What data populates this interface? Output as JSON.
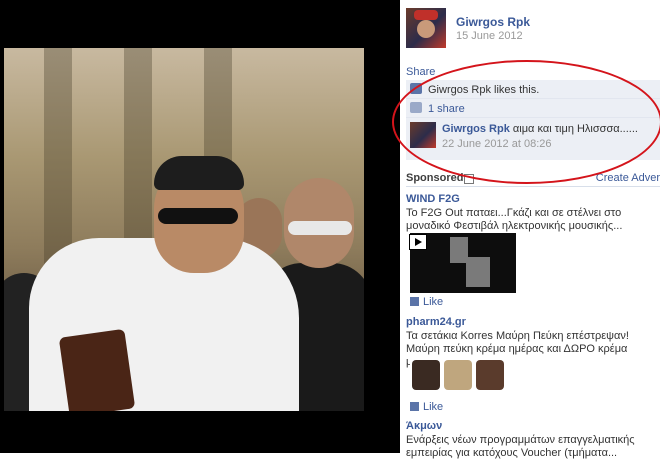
{
  "post": {
    "author": "Giwrgos Rpk",
    "date": "15 June 2012",
    "share_label": "Share",
    "likes_text": "Giwrgos Rpk likes this.",
    "shares_text": "1 share",
    "comment": {
      "author": "Giwrgos Rpk",
      "text": "αιμα και τιμη Ηλισσσα......",
      "time": "22 June 2012 at 08:26"
    }
  },
  "sponsored": {
    "label": "Sponsored",
    "create_advert": "Create Adver"
  },
  "ads": [
    {
      "title": "WIND F2G",
      "text": "Το F2G Out παταει...Γκάζι και σε στέλνει στο μοναδικό Φεστιβάλ ηλεκτρονικής μουσικής...",
      "like_label": "Like"
    },
    {
      "title": "pharm24.gr",
      "text": "Τα σετάκια Korres Μαύρη Πεύκη επέστρεψαν! Μαύρη πεύκη κρέμα ημέρας και ΔΩΡΟ κρέμα ματιών,...",
      "like_label": "Like"
    },
    {
      "title": "Άκμων",
      "text": "Ενάρξεις νέων προγραμμάτων επαγγελματικής εμπειρίας για κατόχους Voucher (τμήματα..."
    }
  ],
  "colors": {
    "link": "#3b5998",
    "annotation_circle": "#d4141b",
    "ufi_background": "#eceff5"
  }
}
